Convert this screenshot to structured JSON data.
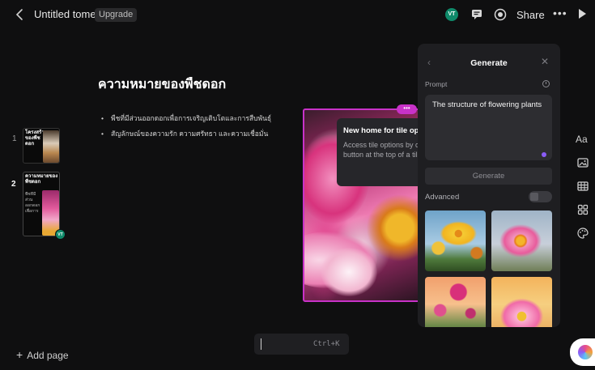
{
  "topbar": {
    "doc_title": "Untitled tome",
    "upgrade_label": "Upgrade",
    "avatar_initials": "VT",
    "share_label": "Share",
    "more_label": "•••"
  },
  "slides": [
    {
      "number": "1",
      "thumb_title": "โครงสร้างของพืชดอก"
    },
    {
      "number": "2",
      "thumb_title": "ความหมายของพืชดอก",
      "thumb_body": "พืชที่มีส่วนออกดอกเพื่อการ"
    }
  ],
  "thumb_avatar": "VT",
  "add_page_label": "Add page",
  "slide": {
    "title": "ความหมายของพืชดอก",
    "bullets": [
      "พืชที่มีส่วนออกดอกเพื่อการเจริญเติบโตและการสืบพันธุ์",
      "สัญลักษณ์ของความรัก ความศรัทธา และความเชื่อมั่น"
    ],
    "frame_menu": "•••"
  },
  "tooltip": {
    "title": "New home for tile options",
    "body": "Access tile options by clicking the button at the top of a tile"
  },
  "panel": {
    "title": "Generate",
    "prompt_label": "Prompt",
    "prompt_value": "The structure of flowering plants",
    "generate_label": "Generate",
    "advanced_label": "Advanced",
    "advanced_enabled": false
  },
  "right_toolbar": {
    "text_label": "Aa"
  },
  "command_bar": {
    "shortcut": "Ctrl+K"
  },
  "colors": {
    "background": "#0f0f10",
    "accent": "#c832c8",
    "avatar": "#0f8a6a",
    "panel": "#1e1e21"
  }
}
